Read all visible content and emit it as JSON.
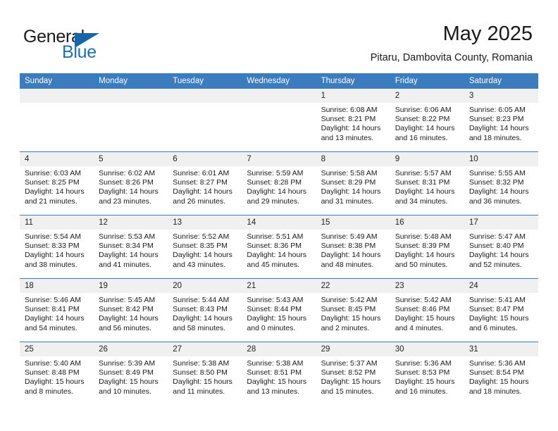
{
  "brand": {
    "word1": "General",
    "word2": "Blue",
    "accent_color": "#1565a8",
    "text_color": "#1a1a1a"
  },
  "header": {
    "month_title": "May 2025",
    "location": "Pitaru, Dambovita County, Romania"
  },
  "calendar": {
    "header_bg": "#3a7cbe",
    "daynum_bg": "#f0f0f0",
    "weekday_headers": [
      "Sunday",
      "Monday",
      "Tuesday",
      "Wednesday",
      "Thursday",
      "Friday",
      "Saturday"
    ],
    "weeks": [
      [
        {
          "day": "",
          "blank": true,
          "sunrise": "",
          "sunset": "",
          "daylight1": "",
          "daylight2": ""
        },
        {
          "day": "",
          "blank": true,
          "sunrise": "",
          "sunset": "",
          "daylight1": "",
          "daylight2": ""
        },
        {
          "day": "",
          "blank": true,
          "sunrise": "",
          "sunset": "",
          "daylight1": "",
          "daylight2": ""
        },
        {
          "day": "",
          "blank": true,
          "sunrise": "",
          "sunset": "",
          "daylight1": "",
          "daylight2": ""
        },
        {
          "day": "1",
          "blank": false,
          "sunrise": "Sunrise: 6:08 AM",
          "sunset": "Sunset: 8:21 PM",
          "daylight1": "Daylight: 14 hours",
          "daylight2": "and 13 minutes."
        },
        {
          "day": "2",
          "blank": false,
          "sunrise": "Sunrise: 6:06 AM",
          "sunset": "Sunset: 8:22 PM",
          "daylight1": "Daylight: 14 hours",
          "daylight2": "and 16 minutes."
        },
        {
          "day": "3",
          "blank": false,
          "sunrise": "Sunrise: 6:05 AM",
          "sunset": "Sunset: 8:23 PM",
          "daylight1": "Daylight: 14 hours",
          "daylight2": "and 18 minutes."
        }
      ],
      [
        {
          "day": "4",
          "blank": false,
          "sunrise": "Sunrise: 6:03 AM",
          "sunset": "Sunset: 8:25 PM",
          "daylight1": "Daylight: 14 hours",
          "daylight2": "and 21 minutes."
        },
        {
          "day": "5",
          "blank": false,
          "sunrise": "Sunrise: 6:02 AM",
          "sunset": "Sunset: 8:26 PM",
          "daylight1": "Daylight: 14 hours",
          "daylight2": "and 23 minutes."
        },
        {
          "day": "6",
          "blank": false,
          "sunrise": "Sunrise: 6:01 AM",
          "sunset": "Sunset: 8:27 PM",
          "daylight1": "Daylight: 14 hours",
          "daylight2": "and 26 minutes."
        },
        {
          "day": "7",
          "blank": false,
          "sunrise": "Sunrise: 5:59 AM",
          "sunset": "Sunset: 8:28 PM",
          "daylight1": "Daylight: 14 hours",
          "daylight2": "and 29 minutes."
        },
        {
          "day": "8",
          "blank": false,
          "sunrise": "Sunrise: 5:58 AM",
          "sunset": "Sunset: 8:29 PM",
          "daylight1": "Daylight: 14 hours",
          "daylight2": "and 31 minutes."
        },
        {
          "day": "9",
          "blank": false,
          "sunrise": "Sunrise: 5:57 AM",
          "sunset": "Sunset: 8:31 PM",
          "daylight1": "Daylight: 14 hours",
          "daylight2": "and 34 minutes."
        },
        {
          "day": "10",
          "blank": false,
          "sunrise": "Sunrise: 5:55 AM",
          "sunset": "Sunset: 8:32 PM",
          "daylight1": "Daylight: 14 hours",
          "daylight2": "and 36 minutes."
        }
      ],
      [
        {
          "day": "11",
          "blank": false,
          "sunrise": "Sunrise: 5:54 AM",
          "sunset": "Sunset: 8:33 PM",
          "daylight1": "Daylight: 14 hours",
          "daylight2": "and 38 minutes."
        },
        {
          "day": "12",
          "blank": false,
          "sunrise": "Sunrise: 5:53 AM",
          "sunset": "Sunset: 8:34 PM",
          "daylight1": "Daylight: 14 hours",
          "daylight2": "and 41 minutes."
        },
        {
          "day": "13",
          "blank": false,
          "sunrise": "Sunrise: 5:52 AM",
          "sunset": "Sunset: 8:35 PM",
          "daylight1": "Daylight: 14 hours",
          "daylight2": "and 43 minutes."
        },
        {
          "day": "14",
          "blank": false,
          "sunrise": "Sunrise: 5:51 AM",
          "sunset": "Sunset: 8:36 PM",
          "daylight1": "Daylight: 14 hours",
          "daylight2": "and 45 minutes."
        },
        {
          "day": "15",
          "blank": false,
          "sunrise": "Sunrise: 5:49 AM",
          "sunset": "Sunset: 8:38 PM",
          "daylight1": "Daylight: 14 hours",
          "daylight2": "and 48 minutes."
        },
        {
          "day": "16",
          "blank": false,
          "sunrise": "Sunrise: 5:48 AM",
          "sunset": "Sunset: 8:39 PM",
          "daylight1": "Daylight: 14 hours",
          "daylight2": "and 50 minutes."
        },
        {
          "day": "17",
          "blank": false,
          "sunrise": "Sunrise: 5:47 AM",
          "sunset": "Sunset: 8:40 PM",
          "daylight1": "Daylight: 14 hours",
          "daylight2": "and 52 minutes."
        }
      ],
      [
        {
          "day": "18",
          "blank": false,
          "sunrise": "Sunrise: 5:46 AM",
          "sunset": "Sunset: 8:41 PM",
          "daylight1": "Daylight: 14 hours",
          "daylight2": "and 54 minutes."
        },
        {
          "day": "19",
          "blank": false,
          "sunrise": "Sunrise: 5:45 AM",
          "sunset": "Sunset: 8:42 PM",
          "daylight1": "Daylight: 14 hours",
          "daylight2": "and 56 minutes."
        },
        {
          "day": "20",
          "blank": false,
          "sunrise": "Sunrise: 5:44 AM",
          "sunset": "Sunset: 8:43 PM",
          "daylight1": "Daylight: 14 hours",
          "daylight2": "and 58 minutes."
        },
        {
          "day": "21",
          "blank": false,
          "sunrise": "Sunrise: 5:43 AM",
          "sunset": "Sunset: 8:44 PM",
          "daylight1": "Daylight: 15 hours",
          "daylight2": "and 0 minutes."
        },
        {
          "day": "22",
          "blank": false,
          "sunrise": "Sunrise: 5:42 AM",
          "sunset": "Sunset: 8:45 PM",
          "daylight1": "Daylight: 15 hours",
          "daylight2": "and 2 minutes."
        },
        {
          "day": "23",
          "blank": false,
          "sunrise": "Sunrise: 5:42 AM",
          "sunset": "Sunset: 8:46 PM",
          "daylight1": "Daylight: 15 hours",
          "daylight2": "and 4 minutes."
        },
        {
          "day": "24",
          "blank": false,
          "sunrise": "Sunrise: 5:41 AM",
          "sunset": "Sunset: 8:47 PM",
          "daylight1": "Daylight: 15 hours",
          "daylight2": "and 6 minutes."
        }
      ],
      [
        {
          "day": "25",
          "blank": false,
          "sunrise": "Sunrise: 5:40 AM",
          "sunset": "Sunset: 8:48 PM",
          "daylight1": "Daylight: 15 hours",
          "daylight2": "and 8 minutes."
        },
        {
          "day": "26",
          "blank": false,
          "sunrise": "Sunrise: 5:39 AM",
          "sunset": "Sunset: 8:49 PM",
          "daylight1": "Daylight: 15 hours",
          "daylight2": "and 10 minutes."
        },
        {
          "day": "27",
          "blank": false,
          "sunrise": "Sunrise: 5:38 AM",
          "sunset": "Sunset: 8:50 PM",
          "daylight1": "Daylight: 15 hours",
          "daylight2": "and 11 minutes."
        },
        {
          "day": "28",
          "blank": false,
          "sunrise": "Sunrise: 5:38 AM",
          "sunset": "Sunset: 8:51 PM",
          "daylight1": "Daylight: 15 hours",
          "daylight2": "and 13 minutes."
        },
        {
          "day": "29",
          "blank": false,
          "sunrise": "Sunrise: 5:37 AM",
          "sunset": "Sunset: 8:52 PM",
          "daylight1": "Daylight: 15 hours",
          "daylight2": "and 15 minutes."
        },
        {
          "day": "30",
          "blank": false,
          "sunrise": "Sunrise: 5:36 AM",
          "sunset": "Sunset: 8:53 PM",
          "daylight1": "Daylight: 15 hours",
          "daylight2": "and 16 minutes."
        },
        {
          "day": "31",
          "blank": false,
          "sunrise": "Sunrise: 5:36 AM",
          "sunset": "Sunset: 8:54 PM",
          "daylight1": "Daylight: 15 hours",
          "daylight2": "and 18 minutes."
        }
      ]
    ]
  }
}
